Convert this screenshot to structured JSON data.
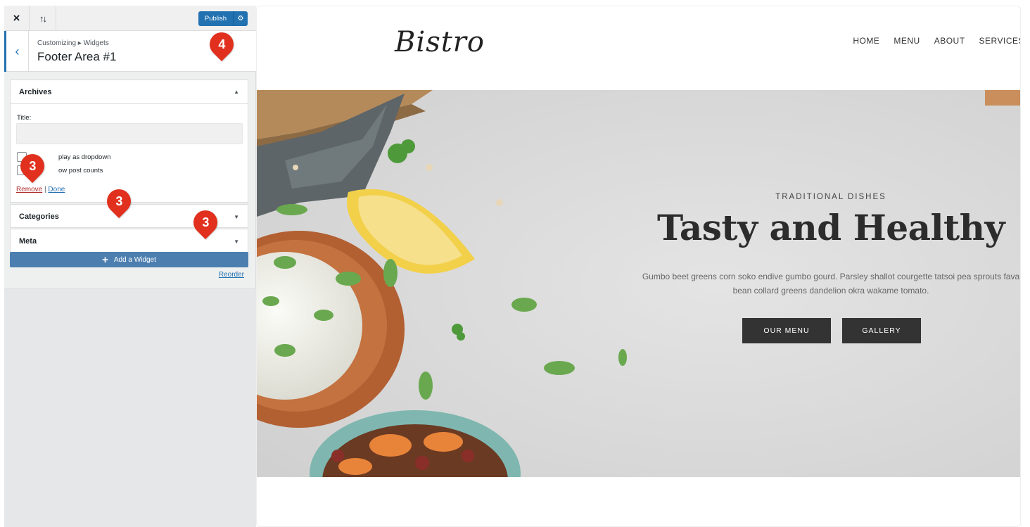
{
  "customizer": {
    "close_icon": "×",
    "sort_icon": "↑↓",
    "publish_label": "Publish",
    "publish_gear_icon": "⚙",
    "back_icon": "‹",
    "breadcrumb": "Customizing ▸ Widgets",
    "section_title": "Footer Area #1",
    "widgets": {
      "archives": {
        "title": "Archives",
        "toggle_icon": "▲",
        "title_label": "Title:",
        "title_value": "",
        "option_dropdown": "play as dropdown",
        "option_counts": "ow post counts",
        "remove_link": "Remove",
        "separator": "|",
        "done_link": "Done"
      },
      "categories": {
        "title": "Categories",
        "toggle_icon": "▼"
      },
      "meta": {
        "title": "Meta",
        "toggle_icon": "▼"
      }
    },
    "add_widget_plus": "+",
    "add_widget_label": "Add a Widget",
    "reorder_label": "Reorder"
  },
  "markers": {
    "remove_marker": "3",
    "categories_marker": "3",
    "meta_marker": "3",
    "publish_marker": "4"
  },
  "site": {
    "logo": "Bistro",
    "nav": [
      "HOME",
      "MENU",
      "ABOUT",
      "SERVICES"
    ],
    "hero": {
      "eyebrow": "TRADITIONAL DISHES",
      "headline": "Tasty and Healthy",
      "description": "Gumbo beet greens corn soko endive gumbo gourd. Parsley shallot courgette tatsoi pea sprouts fava bean collard greens dandelion okra wakame tomato.",
      "button_menu": "OUR MENU",
      "button_gallery": "GALLERY"
    }
  },
  "colors": {
    "wp_blue": "#2271b1",
    "marker_red": "#e1301e",
    "button_dark": "#333333"
  }
}
